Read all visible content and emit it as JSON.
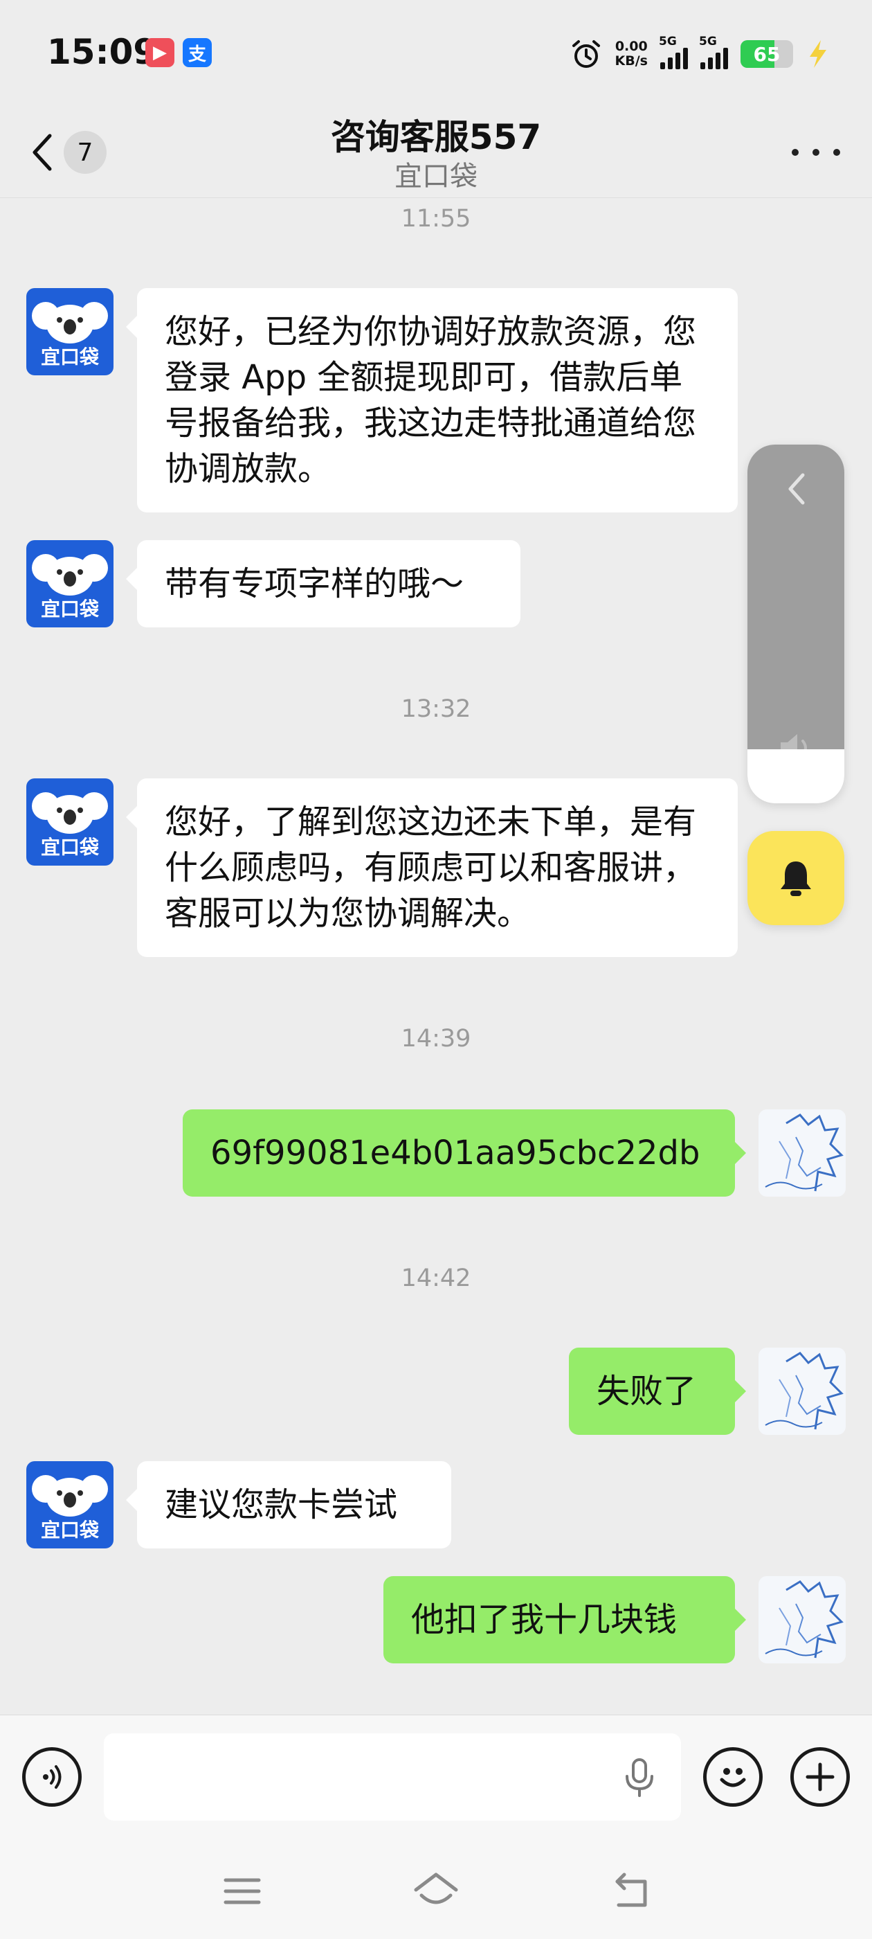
{
  "status_bar": {
    "time": "15:09",
    "app_icons": [
      {
        "name": "video-app-icon",
        "glyph": "▶",
        "color": "#ef4f5a"
      },
      {
        "name": "alipay-icon",
        "glyph": "支",
        "color": "#1677ff"
      }
    ],
    "net_speed_value": "0.00",
    "net_speed_unit": "KB/s",
    "signal_1_label": "5G",
    "signal_2_label": "5G",
    "battery_level": "65",
    "battery_fraction": 0.65
  },
  "header": {
    "back_badge": "7",
    "title": "咨询客服557",
    "subtitle": "宜口袋"
  },
  "avatars": {
    "bot_label": "宜口袋"
  },
  "messages": [
    {
      "kind": "time",
      "text": "11:55"
    },
    {
      "kind": "in",
      "text": "您好，已经为你协调好放款资源，您登录 App 全额提现即可，借款后单号报备给我，我这边走特批通道给您协调放款。"
    },
    {
      "kind": "in",
      "text": "带有专项字样的哦～"
    },
    {
      "kind": "time",
      "text": "13:32"
    },
    {
      "kind": "in",
      "text": "您好，了解到您这边还未下单，是有什么顾虑吗，有顾虑可以和客服讲，客服可以为您协调解决。"
    },
    {
      "kind": "time",
      "text": "14:39"
    },
    {
      "kind": "out",
      "text": "69f99081e4b01aa95cbc22db"
    },
    {
      "kind": "time",
      "text": "14:42"
    },
    {
      "kind": "out",
      "text": "失败了"
    },
    {
      "kind": "in",
      "text": "建议您款卡尝试"
    },
    {
      "kind": "out",
      "text": "他扣了我十几块钱"
    }
  ],
  "input_bar": {
    "value": ""
  },
  "colors": {
    "outgoing_bubble": "#95ec69",
    "incoming_bubble": "#ffffff",
    "background": "#ededed",
    "bell_widget": "#fbe45a"
  }
}
